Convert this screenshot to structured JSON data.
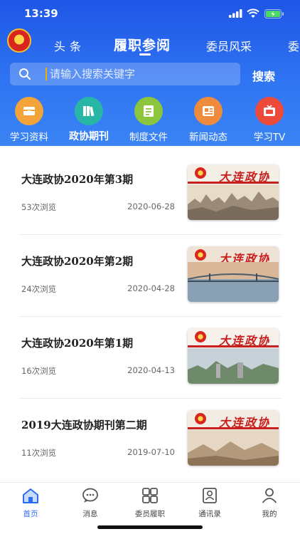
{
  "status_bar": {
    "time": "13:39"
  },
  "top_tabs": [
    {
      "label": "头条"
    },
    {
      "label": "履职参阅",
      "active": true
    },
    {
      "label": "委员风采"
    },
    {
      "label": "委"
    }
  ],
  "search": {
    "placeholder": "请输入搜索关键字",
    "button_label": "搜索"
  },
  "categories": [
    {
      "label": "学习资料",
      "color": "#f2a43a",
      "icon": "folder-icon"
    },
    {
      "label": "政协期刊",
      "color": "#29b6a6",
      "icon": "books-icon",
      "active": true
    },
    {
      "label": "制度文件",
      "color": "#8cc63f",
      "icon": "document-icon"
    },
    {
      "label": "新闻动态",
      "color": "#f08a3c",
      "icon": "newspaper-icon"
    },
    {
      "label": "学习TV",
      "color": "#ec4b3c",
      "icon": "tv-icon"
    }
  ],
  "articles": [
    {
      "title": "大连政协2020年第3期",
      "views": "53次浏览",
      "date": "2020-06-28",
      "cover_mast": "大连政协"
    },
    {
      "title": "大连政协2020年第2期",
      "views": "24次浏览",
      "date": "2020-04-28",
      "cover_mast": "大连政协"
    },
    {
      "title": "大连政协2020年第1期",
      "views": "16次浏览",
      "date": "2020-04-13",
      "cover_mast": "大连政协"
    },
    {
      "title": "2019大连政协期刊第二期",
      "views": "11次浏览",
      "date": "2019-07-10",
      "cover_mast": "大连政协"
    }
  ],
  "bottom_tabs": [
    {
      "label": "首页",
      "icon": "home-icon",
      "active": true
    },
    {
      "label": "消息",
      "icon": "chat-icon"
    },
    {
      "label": "委员履职",
      "icon": "grid-icon"
    },
    {
      "label": "通讯录",
      "icon": "contacts-icon"
    },
    {
      "label": "我的",
      "icon": "person-icon"
    }
  ],
  "colors": {
    "header_blue": "#2563eb",
    "accent": "#2c6cf0"
  }
}
